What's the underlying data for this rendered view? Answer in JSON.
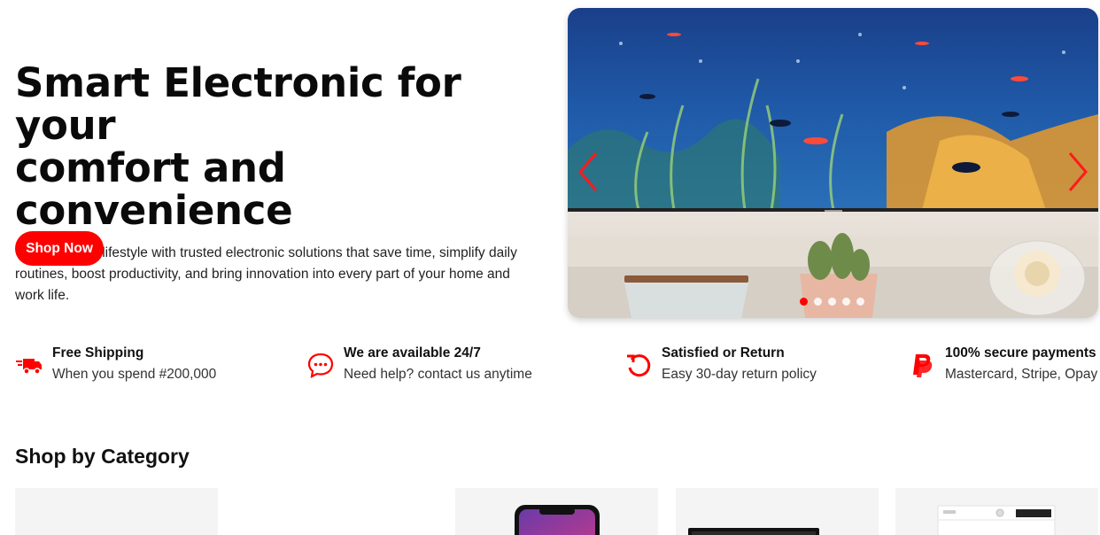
{
  "hero": {
    "title_line1": "Smart Electronic for your",
    "title_line2": "comfort and convenience",
    "description": "Upgrade your lifestyle with trusted electronic solutions that save time, simplify daily routines, boost productivity, and bring innovation into every part of your home and work life.",
    "cta_label": "Shop Now"
  },
  "carousel": {
    "slide_count": 5,
    "active_slide": 1,
    "prev_icon": "chevron-left-icon",
    "next_icon": "chevron-right-icon"
  },
  "features": [
    {
      "icon": "delivery-truck-icon",
      "title": "Free Shipping",
      "subtitle": "When you spend #200,000"
    },
    {
      "icon": "chat-bubble-icon",
      "title": "We are available 24/7",
      "subtitle": "Need help? contact us anytime"
    },
    {
      "icon": "return-arrow-icon",
      "title": "Satisfied or Return",
      "subtitle": "Easy 30-day return policy"
    },
    {
      "icon": "paypal-icon",
      "title": "100% secure payments",
      "subtitle": "Mastercard, Stripe, Opay"
    }
  ],
  "categories": {
    "heading": "Shop by Category"
  },
  "colors": {
    "accent": "#ff0000",
    "card_bg": "#f4f4f4",
    "text": "#111111"
  }
}
